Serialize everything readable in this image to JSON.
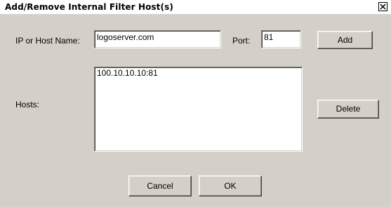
{
  "window": {
    "title": "Add/Remove Internal Filter Host(s)",
    "close_icon": "close-icon"
  },
  "form": {
    "host_label": "IP or Host Name:",
    "host_value": "logoserver.com",
    "port_label": "Port:",
    "port_value": "81",
    "hosts_label": "Hosts:"
  },
  "hosts": {
    "items": [
      "100.10.10.10:81"
    ]
  },
  "buttons": {
    "add": "Add",
    "delete": "Delete",
    "cancel": "Cancel",
    "ok": "OK"
  }
}
